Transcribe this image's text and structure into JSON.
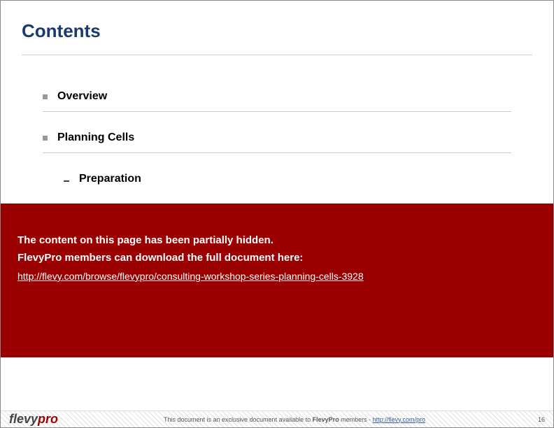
{
  "header": {
    "title": "Contents"
  },
  "content": {
    "items": [
      {
        "label": "Overview",
        "level": 1
      },
      {
        "label": "Planning Cells",
        "level": 1
      },
      {
        "label": "Preparation",
        "level": 2
      }
    ]
  },
  "overlay": {
    "line1": "The content on this page has been partially hidden.",
    "line2": "FlevyPro members can download the full document here:",
    "link_text": "http://flevy.com/browse/flevypro/consulting-workshop-series-planning-cells-3928"
  },
  "footer": {
    "logo_part1": "flevy",
    "logo_part2": "pro",
    "text_prefix": "This document is an exclusive document available to ",
    "text_bold": "FlevyPro",
    "text_middle": " members - ",
    "text_link": "http://flevy.com/pro",
    "page_number": "16"
  }
}
